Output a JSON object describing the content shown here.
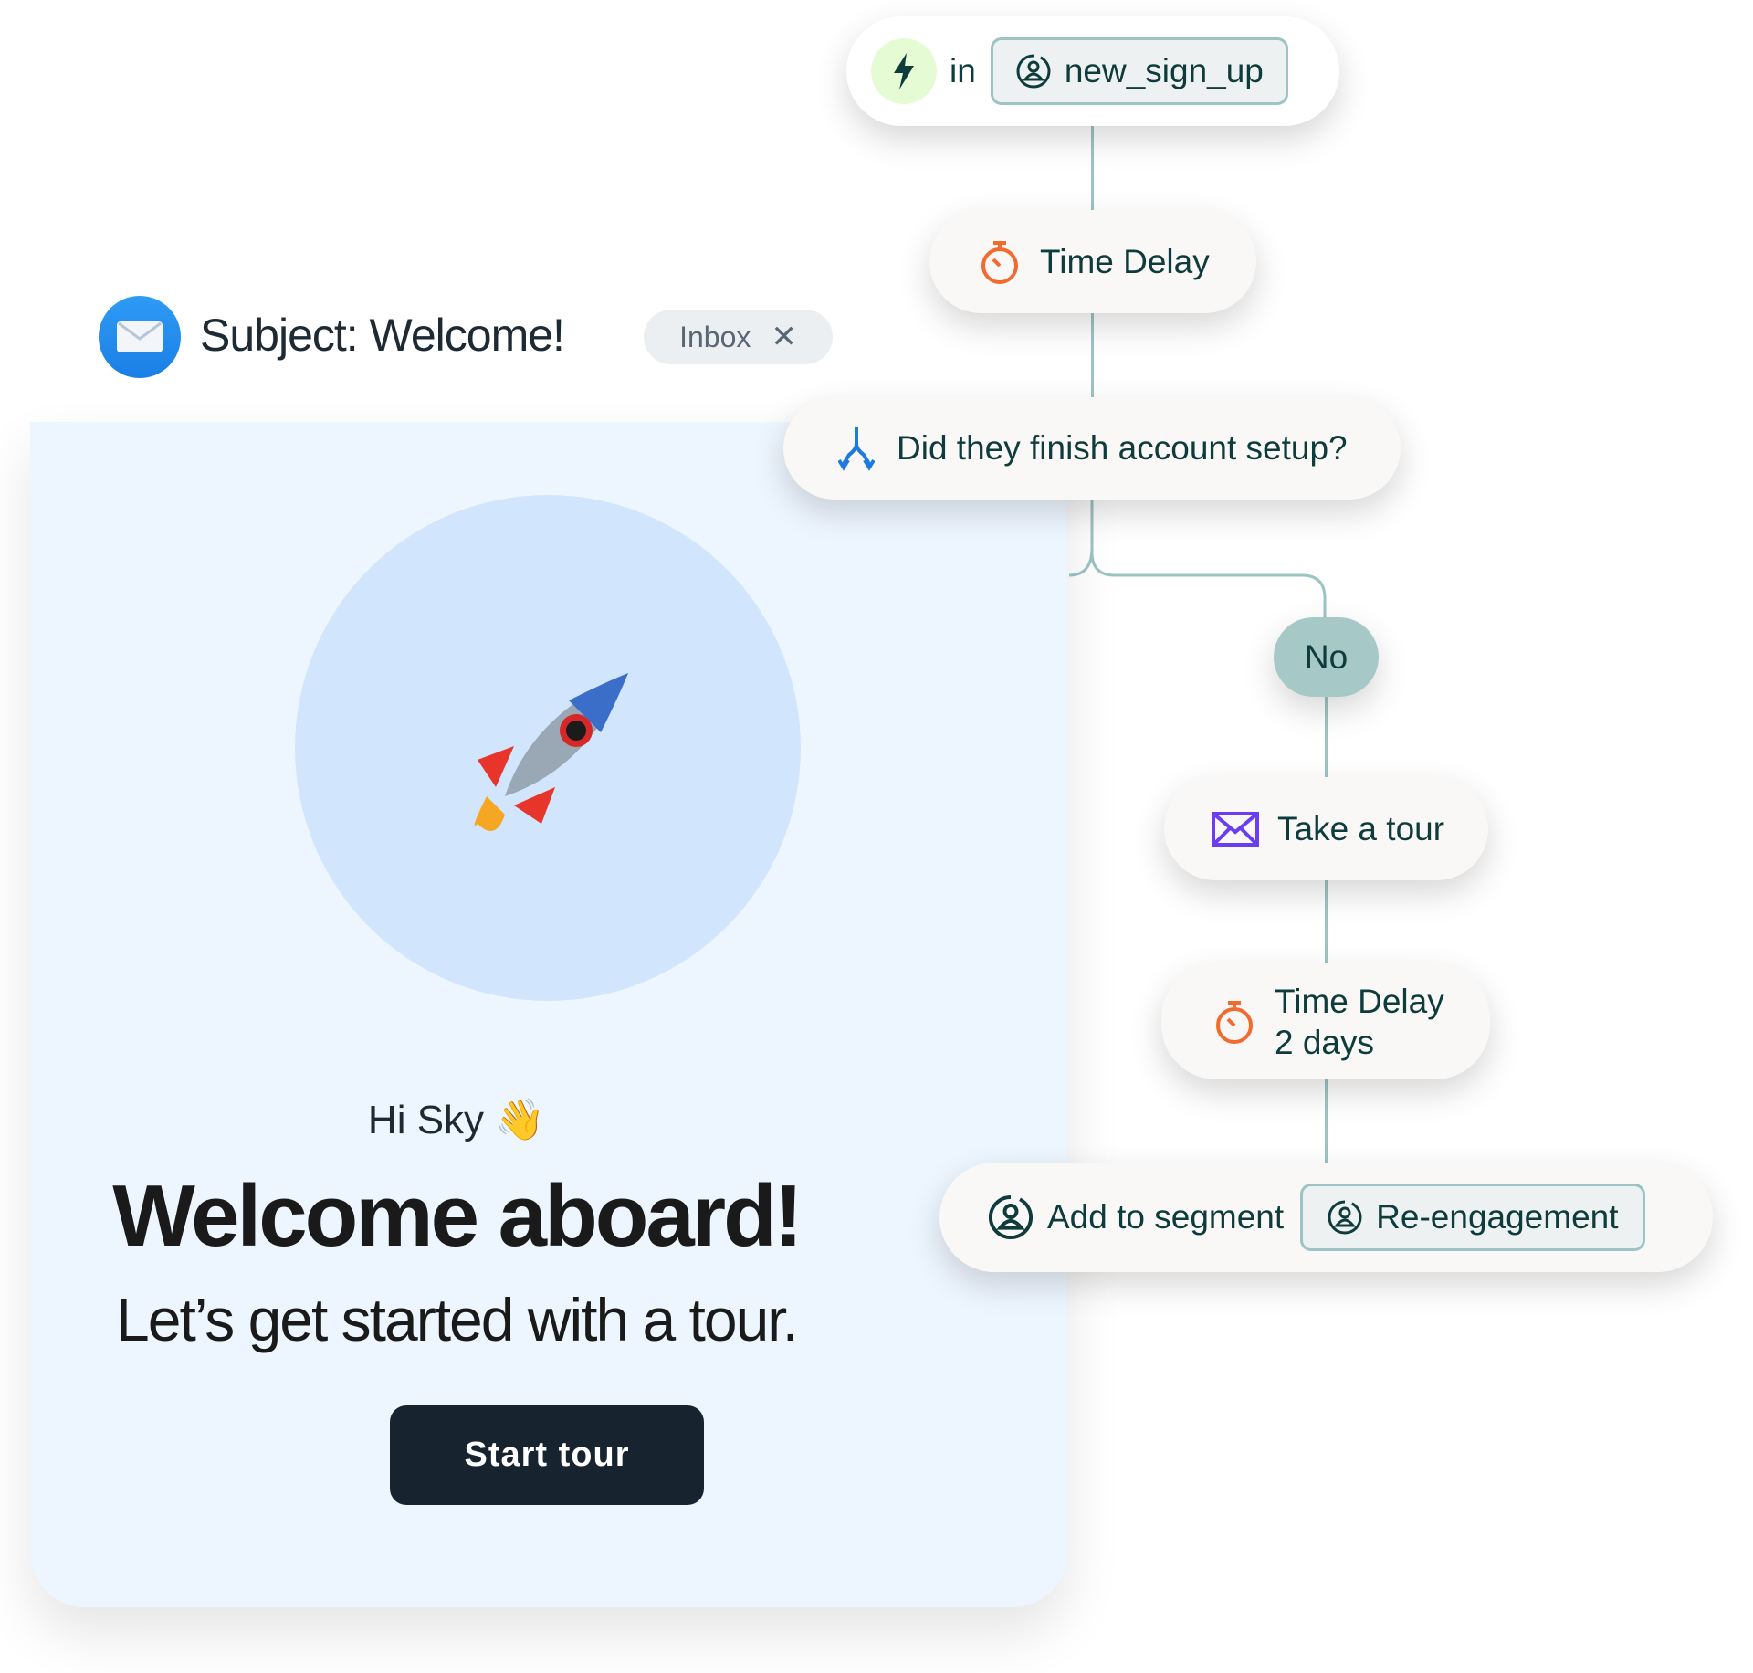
{
  "email": {
    "subject": "Subject: Welcome!",
    "folder_chip": "Inbox",
    "greeting": "Hi Sky",
    "greeting_emoji": "👋",
    "headline": "Welcome aboard!",
    "subheadline": "Let’s get started with a tour.",
    "cta_label": "Start tour",
    "hero_icon": "rocket-icon",
    "colors": {
      "card_bg": "#edf5fe",
      "hero_circle": "#d1e5fd",
      "button_bg": "#17242f"
    }
  },
  "workflow": {
    "trigger": {
      "icon": "lightning-icon",
      "connector": "in",
      "segment": "new_sign_up"
    },
    "delay_1": {
      "icon": "stopwatch-icon",
      "label": "Time Delay"
    },
    "decision": {
      "icon": "branch-icon",
      "label": "Did they finish account setup?"
    },
    "branch_label": "No",
    "email_step": {
      "icon": "envelope-icon",
      "label": "Take a tour"
    },
    "delay_2": {
      "icon": "stopwatch-icon",
      "label": "Time Delay",
      "detail": "2 days"
    },
    "segment_step": {
      "icon": "user-circle-icon",
      "label": "Add to segment",
      "segment": "Re-engagement"
    },
    "colors": {
      "connector": "#9cc4c4",
      "text": "#0e3b3b",
      "timer": "#f26b2e",
      "branch": "#1f7ae0",
      "envelope": "#6a3df0",
      "no_pill": "#a6c9c8",
      "trigger_bg": "#e4fbd3"
    }
  }
}
